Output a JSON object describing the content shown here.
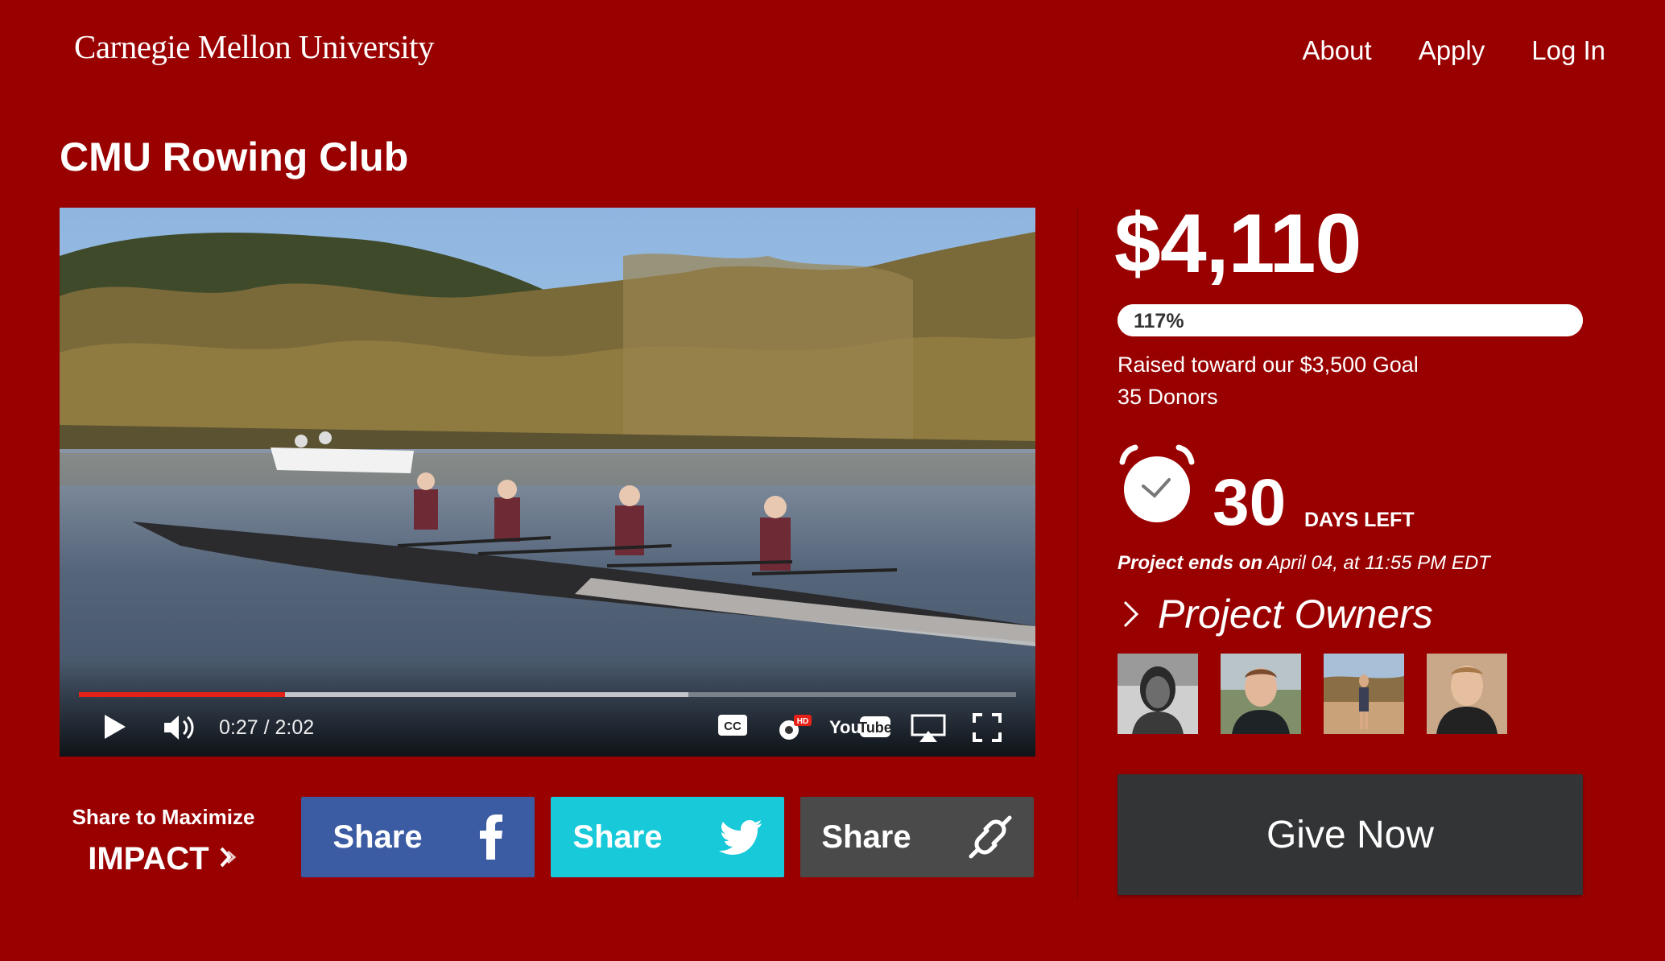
{
  "header": {
    "logo_text": "Carnegie Mellon University",
    "nav": {
      "about": "About",
      "apply": "Apply",
      "login": "Log In"
    }
  },
  "page": {
    "title": "CMU Rowing Club"
  },
  "video": {
    "time": "0:27 / 2:02",
    "played_fraction": 0.22,
    "loaded_fraction": 0.65,
    "colors": {
      "played": "#e62117"
    }
  },
  "share": {
    "label_line1": "Share to Maximize",
    "label_line2": "IMPACT",
    "facebook": "Share",
    "twitter": "Share",
    "link": "Share",
    "colors": {
      "facebook": "#3b5ba3",
      "twitter": "#18c9d9",
      "link": "#4a4a4a"
    }
  },
  "campaign": {
    "amount": "$4,110",
    "percent": "117%",
    "percent_value": 1.17,
    "raised_text": "Raised toward our $3,500 Goal",
    "donors_text": "35 Donors",
    "days_number": "30",
    "days_label": "DAYS LEFT",
    "ends_label": "Project ends on",
    "ends_value": "April 04, at 11:55 PM EDT",
    "owners_title": "Project Owners",
    "give_label": "Give Now"
  },
  "colors": {
    "background": "#990000",
    "give_button": "#333436"
  }
}
